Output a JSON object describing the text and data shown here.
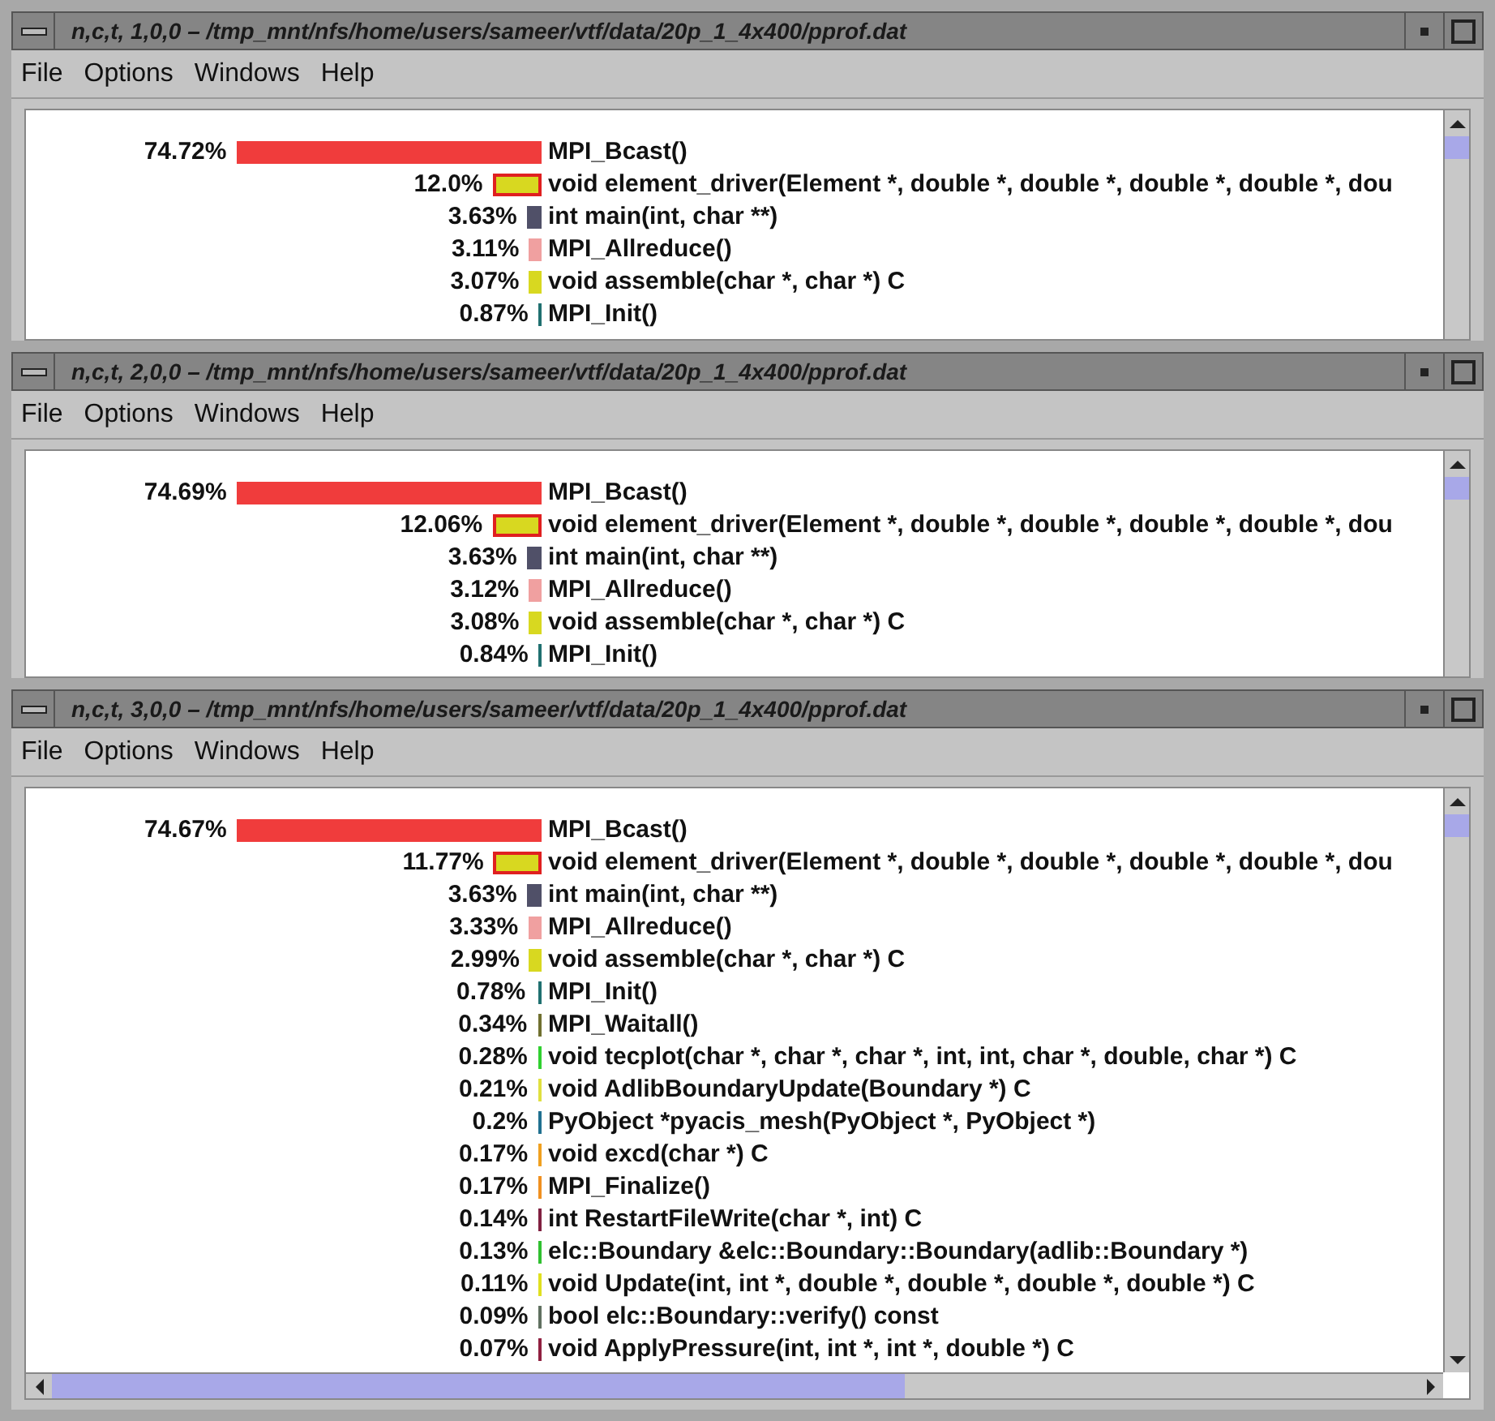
{
  "windows": [
    {
      "title": "n,c,t, 1,0,0 – /tmp_mnt/nfs/home/users/sameer/vtf/data/20p_1_4x400/pprof.dat",
      "menu": [
        "File",
        "Options",
        "Windows",
        "Help"
      ],
      "horizontal_scrollbar": false,
      "rows": [
        {
          "percent": "74.72%",
          "color": "#f03c3c",
          "highlighted": false,
          "name": "MPI_Bcast()"
        },
        {
          "percent": "12.0%",
          "color": "#d8d820",
          "highlighted": true,
          "name": "void element_driver(Element *, double *, double *, double *, double *, dou"
        },
        {
          "percent": "3.63%",
          "color": "#505068",
          "highlighted": false,
          "name": "int main(int, char **)"
        },
        {
          "percent": "3.11%",
          "color": "#f0a0a0",
          "highlighted": false,
          "name": "MPI_Allreduce()"
        },
        {
          "percent": "3.07%",
          "color": "#d8d820",
          "highlighted": false,
          "name": "void assemble(char *, char *) C"
        },
        {
          "percent": "0.87%",
          "color": "#207070",
          "highlighted": false,
          "name": "MPI_Init()"
        }
      ]
    },
    {
      "title": "n,c,t, 2,0,0 – /tmp_mnt/nfs/home/users/sameer/vtf/data/20p_1_4x400/pprof.dat",
      "menu": [
        "File",
        "Options",
        "Windows",
        "Help"
      ],
      "horizontal_scrollbar": false,
      "rows": [
        {
          "percent": "74.69%",
          "color": "#f03c3c",
          "highlighted": false,
          "name": "MPI_Bcast()"
        },
        {
          "percent": "12.06%",
          "color": "#d8d820",
          "highlighted": true,
          "name": "void element_driver(Element *, double *, double *, double *, double *, dou"
        },
        {
          "percent": "3.63%",
          "color": "#505068",
          "highlighted": false,
          "name": "int main(int, char **)"
        },
        {
          "percent": "3.12%",
          "color": "#f0a0a0",
          "highlighted": false,
          "name": "MPI_Allreduce()"
        },
        {
          "percent": "3.08%",
          "color": "#d8d820",
          "highlighted": false,
          "name": "void assemble(char *, char *) C"
        },
        {
          "percent": "0.84%",
          "color": "#207070",
          "highlighted": false,
          "name": "MPI_Init()"
        }
      ]
    },
    {
      "title": "n,c,t, 3,0,0 – /tmp_mnt/nfs/home/users/sameer/vtf/data/20p_1_4x400/pprof.dat",
      "menu": [
        "File",
        "Options",
        "Windows",
        "Help"
      ],
      "horizontal_scrollbar": true,
      "rows": [
        {
          "percent": "74.67%",
          "color": "#f03c3c",
          "highlighted": false,
          "name": "MPI_Bcast()"
        },
        {
          "percent": "11.77%",
          "color": "#d8d820",
          "highlighted": true,
          "name": "void element_driver(Element *, double *, double *, double *, double *, dou"
        },
        {
          "percent": "3.63%",
          "color": "#505068",
          "highlighted": false,
          "name": "int main(int, char **)"
        },
        {
          "percent": "3.33%",
          "color": "#f0a0a0",
          "highlighted": false,
          "name": "MPI_Allreduce()"
        },
        {
          "percent": "2.99%",
          "color": "#d8d820",
          "highlighted": false,
          "name": "void assemble(char *, char *) C"
        },
        {
          "percent": "0.78%",
          "color": "#207070",
          "highlighted": false,
          "name": "MPI_Init()"
        },
        {
          "percent": "0.34%",
          "color": "#707030",
          "highlighted": false,
          "name": "MPI_Waitall()"
        },
        {
          "percent": "0.28%",
          "color": "#30d030",
          "highlighted": false,
          "name": "void tecplot(char *, char *, char *, int, int, char *, double, char *) C"
        },
        {
          "percent": "0.21%",
          "color": "#e0e040",
          "highlighted": false,
          "name": "void AdlibBoundaryUpdate(Boundary *) C"
        },
        {
          "percent": "0.2%",
          "color": "#207090",
          "highlighted": false,
          "name": "PyObject *pyacis_mesh(PyObject *, PyObject *)"
        },
        {
          "percent": "0.17%",
          "color": "#f0a020",
          "highlighted": false,
          "name": "void excd(char *) C"
        },
        {
          "percent": "0.17%",
          "color": "#f09020",
          "highlighted": false,
          "name": "MPI_Finalize()"
        },
        {
          "percent": "0.14%",
          "color": "#802040",
          "highlighted": false,
          "name": "int RestartFileWrite(char *, int) C"
        },
        {
          "percent": "0.13%",
          "color": "#30c030",
          "highlighted": false,
          "name": "elc::Boundary &elc::Boundary::Boundary(adlib::Boundary *)"
        },
        {
          "percent": "0.11%",
          "color": "#e0e020",
          "highlighted": false,
          "name": "void Update(int, int *, double *, double *, double *, double *) C"
        },
        {
          "percent": "0.09%",
          "color": "#607060",
          "highlighted": false,
          "name": "bool elc::Boundary::verify() const"
        },
        {
          "percent": "0.07%",
          "color": "#902040",
          "highlighted": false,
          "name": "void ApplyPressure(int, int *, int *, double *) C"
        }
      ]
    }
  ]
}
